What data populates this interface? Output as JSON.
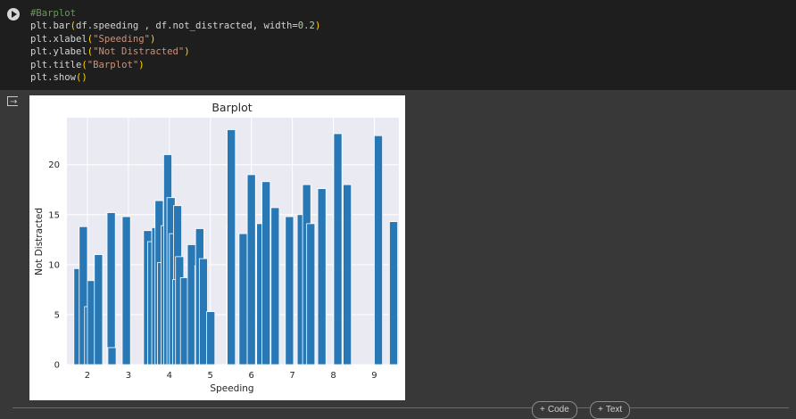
{
  "code_cell": {
    "comment": "#Barplot",
    "line1": {
      "fn": "plt.bar",
      "args": "df.speeding , df.not_distracted, width=",
      "num": "0.2"
    },
    "line2": {
      "fn": "plt.xlabel",
      "arg": "\"Speeding\""
    },
    "line3": {
      "fn": "plt.ylabel",
      "arg": "\"Not Distracted\""
    },
    "line4": {
      "fn": "plt.title",
      "arg": "\"Barplot\""
    },
    "line5": {
      "fn": "plt.show"
    }
  },
  "toolbar": {
    "add_code": "Code",
    "add_text": "Text"
  },
  "colors": {
    "bar": "#2878b5",
    "axes_bg": "#eaeaf2",
    "grid": "#ffffff"
  },
  "icons": {
    "run": "play-circle-icon",
    "output": "output-icon"
  },
  "chart_data": {
    "type": "bar",
    "title": "Barplot",
    "xlabel": "Speeding",
    "ylabel": "Not Distracted",
    "bar_width": 0.2,
    "xlim": [
      1.5,
      9.6
    ],
    "ylim": [
      0,
      24.7
    ],
    "xticks": [
      2,
      3,
      4,
      5,
      6,
      7,
      8,
      9
    ],
    "yticks": [
      0,
      5,
      10,
      15,
      20
    ],
    "grid": true,
    "x": [
      1.77,
      1.9,
      2.03,
      2.1,
      2.27,
      2.58,
      2.6,
      2.95,
      3.47,
      3.57,
      3.67,
      3.75,
      3.81,
      3.9,
      3.96,
      4.04,
      4.1,
      4.2,
      4.18,
      4.25,
      4.37,
      4.54,
      4.72,
      4.74,
      4.83,
      5.01,
      5.5,
      5.51,
      5.8,
      6.0,
      6.23,
      6.36,
      6.58,
      6.93,
      7.22,
      7.35,
      7.45,
      7.72,
      8.11,
      8.34,
      9.1,
      9.47
    ],
    "values": [
      9.6,
      13.8,
      5.8,
      8.4,
      11.0,
      15.2,
      1.7,
      14.8,
      13.4,
      12.3,
      13.7,
      16.4,
      10.2,
      13.9,
      21.0,
      16.7,
      13.1,
      15.9,
      8.5,
      10.8,
      8.7,
      12.0,
      9.9,
      13.6,
      10.6,
      5.3,
      14.0,
      23.5,
      13.1,
      19.0,
      14.1,
      18.3,
      15.7,
      14.8,
      15.0,
      18.0,
      14.1,
      17.6,
      23.1,
      18.0,
      22.9,
      14.3
    ]
  }
}
